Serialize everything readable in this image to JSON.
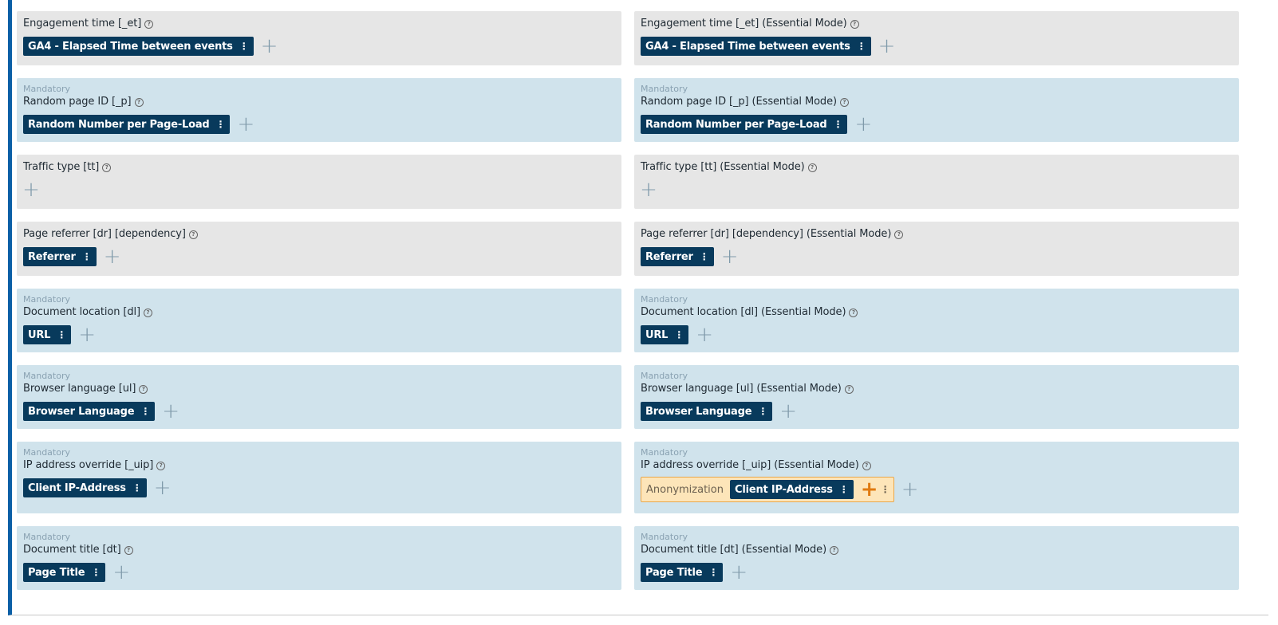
{
  "rows": [
    {
      "left": {
        "mandatory": "",
        "label": "Engagement time [_et]",
        "chips": [
          "GA4 - Elapsed Time between events"
        ]
      },
      "right": {
        "mandatory": "",
        "label": "Engagement time [_et] (Essential Mode)",
        "chips": [
          "GA4 - Elapsed Time between events"
        ]
      }
    },
    {
      "left": {
        "mandatory": "Mandatory",
        "label": "Random page ID [_p]",
        "chips": [
          "Random Number per Page-Load"
        ]
      },
      "right": {
        "mandatory": "Mandatory",
        "label": "Random page ID [_p] (Essential Mode)",
        "chips": [
          "Random Number per Page-Load"
        ]
      }
    },
    {
      "left": {
        "mandatory": "",
        "label": "Traffic type [tt]",
        "chips": []
      },
      "right": {
        "mandatory": "",
        "label": "Traffic type [tt] (Essential Mode)",
        "chips": []
      }
    },
    {
      "left": {
        "mandatory": "",
        "label": "Page referrer [dr] [dependency]",
        "chips": [
          "Referrer"
        ]
      },
      "right": {
        "mandatory": "",
        "label": "Page referrer [dr] [dependency] (Essential Mode)",
        "chips": [
          "Referrer"
        ]
      }
    },
    {
      "left": {
        "mandatory": "Mandatory",
        "label": "Document location [dl]",
        "chips": [
          "URL"
        ]
      },
      "right": {
        "mandatory": "Mandatory",
        "label": "Document location [dl] (Essential Mode)",
        "chips": [
          "URL"
        ]
      }
    },
    {
      "left": {
        "mandatory": "Mandatory",
        "label": "Browser language [ul]",
        "chips": [
          "Browser Language"
        ]
      },
      "right": {
        "mandatory": "Mandatory",
        "label": "Browser language [ul] (Essential Mode)",
        "chips": [
          "Browser Language"
        ]
      }
    },
    {
      "left": {
        "mandatory": "Mandatory",
        "label": "IP address override [_uip]",
        "chips": [
          "Client IP-Address"
        ]
      },
      "right": {
        "mandatory": "Mandatory",
        "label": "IP address override [_uip] (Essential Mode)",
        "anonymization": {
          "label": "Anonymization",
          "chip": "Client IP-Address"
        }
      }
    },
    {
      "left": {
        "mandatory": "Mandatory",
        "label": "Document title [dt]",
        "chips": [
          "Page Title"
        ]
      },
      "right": {
        "mandatory": "Mandatory",
        "label": "Document title [dt] (Essential Mode)",
        "chips": [
          "Page Title"
        ]
      }
    }
  ],
  "icons": {
    "help": "question-circle-icon",
    "add": "plus-icon",
    "menu": "kebab-menu-icon"
  },
  "symbols": {
    "help": "?",
    "add": "+",
    "menu": "⋮"
  },
  "colors": {
    "accent": "#0b5fa6",
    "chip": "#083a5c",
    "mandatory_bg": "#d0e3ec",
    "optional_bg": "#e6e6e6",
    "anonymization_bg": "#fde5b9",
    "anonymization_plus": "#e07a10"
  }
}
